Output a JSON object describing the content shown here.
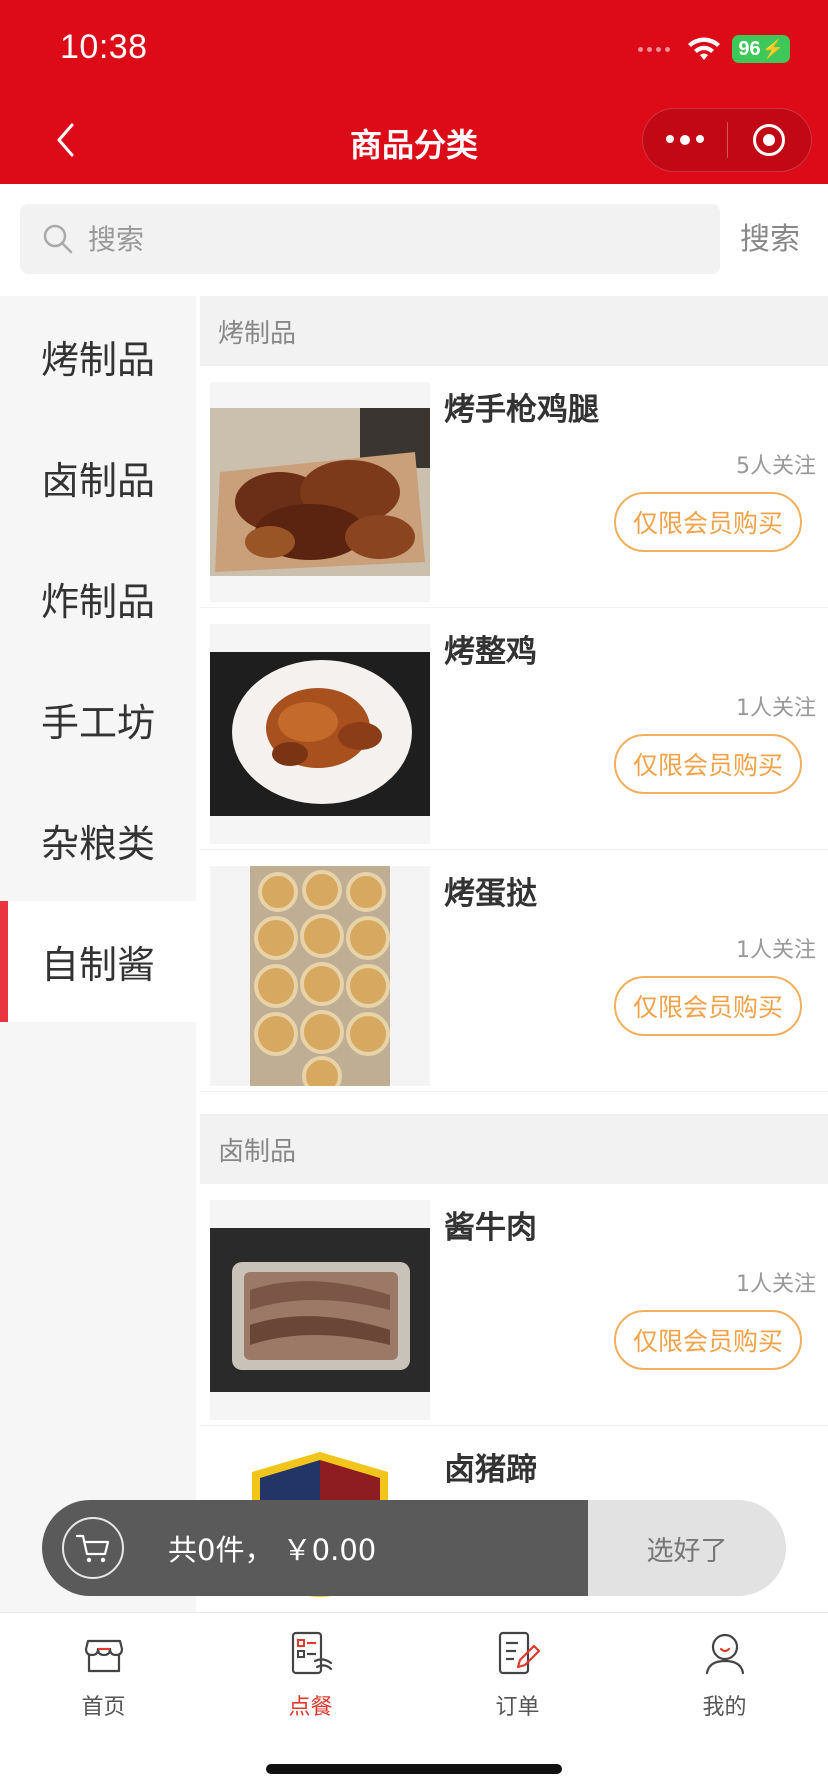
{
  "status_bar": {
    "time": "10:38",
    "battery": "96"
  },
  "nav": {
    "title": "商品分类"
  },
  "search": {
    "placeholder": "搜索",
    "button_label": "搜索"
  },
  "sidebar": {
    "items": [
      {
        "label": "烤制品"
      },
      {
        "label": "卤制品"
      },
      {
        "label": "炸制品"
      },
      {
        "label": "手工坊"
      },
      {
        "label": "杂粮类"
      },
      {
        "label": "自制酱"
      }
    ],
    "active_index": 5
  },
  "sections": [
    {
      "title": "烤制品",
      "products": [
        {
          "name": "烤手枪鸡腿",
          "follow": "5人关注",
          "button": "仅限会员购买"
        },
        {
          "name": "烤整鸡",
          "follow": "1人关注",
          "button": "仅限会员购买"
        },
        {
          "name": "烤蛋挞",
          "follow": "1人关注",
          "button": "仅限会员购买"
        }
      ]
    },
    {
      "title": "卤制品",
      "products": [
        {
          "name": "酱牛肉",
          "follow": "1人关注",
          "button": "仅限会员购买"
        },
        {
          "name": "卤猪蹄",
          "follow": "",
          "button": ""
        }
      ]
    }
  ],
  "cart": {
    "summary": "共0件，  ￥0.00",
    "checkout_label": "选好了"
  },
  "tabbar": {
    "items": [
      {
        "label": "首页",
        "icon": "store-icon"
      },
      {
        "label": "点餐",
        "icon": "menu-order-icon"
      },
      {
        "label": "订单",
        "icon": "order-edit-icon"
      },
      {
        "label": "我的",
        "icon": "user-icon"
      }
    ],
    "active_index": 1
  },
  "colors": {
    "brand_red": "#dd0a17",
    "accent_orange": "#f0a34a",
    "tab_active": "#e03a2f"
  }
}
